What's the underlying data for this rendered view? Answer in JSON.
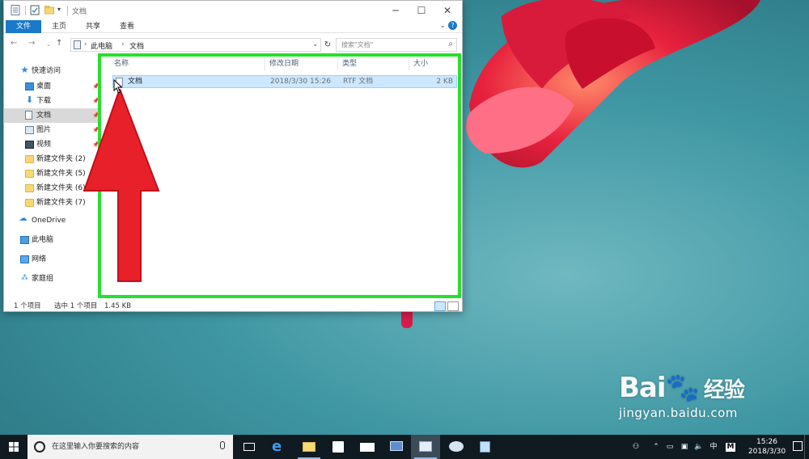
{
  "window": {
    "title": "文档",
    "ribbon_tabs": [
      "文件",
      "主页",
      "共享",
      "查看"
    ]
  },
  "address": {
    "crumbs": [
      "此电脑",
      "文档"
    ]
  },
  "search": {
    "placeholder": "搜索\"文档\""
  },
  "sidebar": {
    "items": [
      {
        "label": "快速访问",
        "icon": "star-icon"
      },
      {
        "label": "桌面",
        "icon": "desktop-icon",
        "pinned": true
      },
      {
        "label": "下载",
        "icon": "download-icon",
        "pinned": true
      },
      {
        "label": "文档",
        "icon": "document-icon",
        "pinned": true,
        "selected": true
      },
      {
        "label": "图片",
        "icon": "pictures-icon",
        "pinned": true
      },
      {
        "label": "视频",
        "icon": "video-icon",
        "pinned": true
      },
      {
        "label": "新建文件夹 (2)",
        "icon": "folder-icon"
      },
      {
        "label": "新建文件夹 (5)",
        "icon": "folder-icon"
      },
      {
        "label": "新建文件夹 (6)",
        "icon": "folder-icon"
      },
      {
        "label": "新建文件夹 (7)",
        "icon": "folder-icon"
      },
      {
        "label": "OneDrive",
        "icon": "cloud-icon"
      },
      {
        "label": "此电脑",
        "icon": "computer-icon"
      },
      {
        "label": "网络",
        "icon": "network-icon"
      },
      {
        "label": "家庭组",
        "icon": "homegroup-icon"
      }
    ]
  },
  "columns": [
    "名称",
    "修改日期",
    "类型",
    "大小"
  ],
  "files": [
    {
      "name": "文档",
      "modified": "2018/3/30 15:26",
      "type": "RTF 文档",
      "size": "2 KB",
      "selected": true
    }
  ],
  "status": {
    "count": "1 个项目",
    "selected": "选中 1 个项目",
    "size": "1.45 KB"
  },
  "taskbar": {
    "search_placeholder": "在这里输入你要搜索的内容",
    "ime_lang": "中",
    "ime_mode": "M",
    "time": "15:26",
    "date": "2018/3/30"
  },
  "watermark": {
    "logo": "Bai",
    "logo_cn": "经验",
    "url": "jingyan.baidu.com"
  },
  "colors": {
    "accent": "#1979ca",
    "selection": "#cce8ff",
    "highlight_frame": "#27e02e",
    "annotation_arrow": "#e8202a"
  }
}
